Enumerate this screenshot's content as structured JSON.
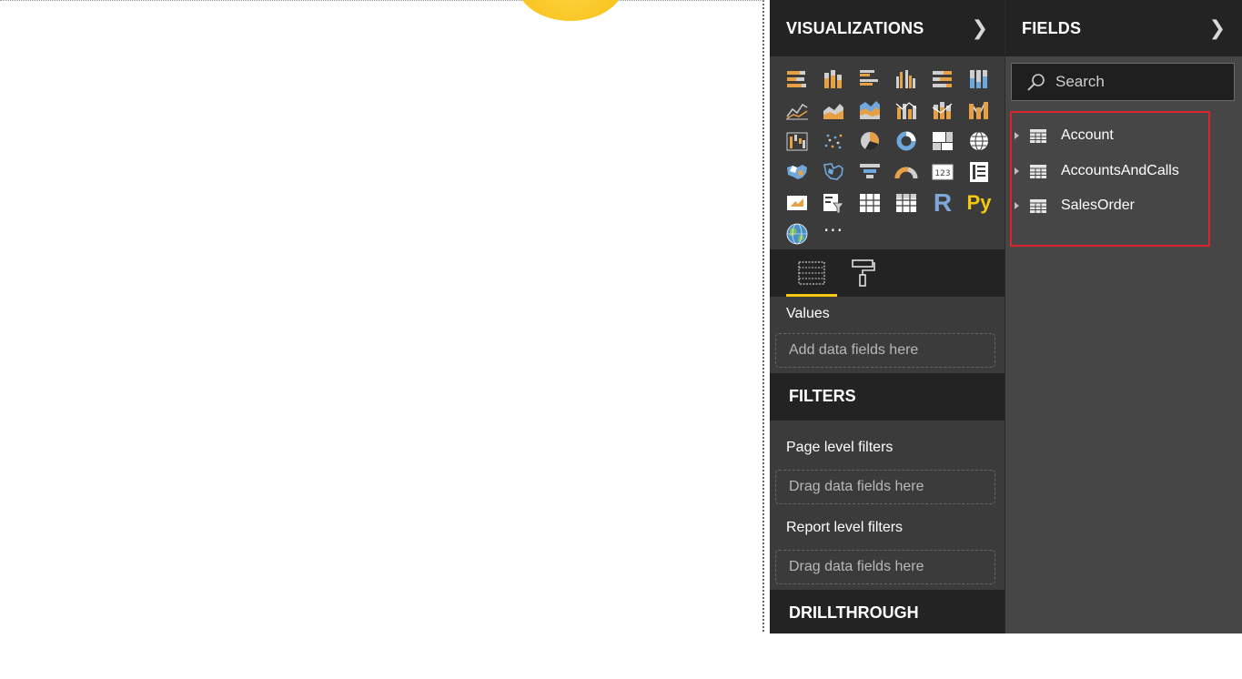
{
  "visualizations": {
    "title": "VISUALIZATIONS",
    "expand_icon": "chevron-right-icon",
    "gallery": [
      "stacked-bar-icon",
      "stacked-column-icon",
      "clustered-bar-icon",
      "clustered-column-icon",
      "100-stacked-bar-icon",
      "100-stacked-column-icon",
      "line-chart-icon",
      "area-chart-icon",
      "stacked-area-icon",
      "line-clustered-column-icon",
      "line-stacked-column-icon",
      "ribbon-chart-icon",
      "waterfall-chart-icon",
      "scatter-chart-icon",
      "pie-chart-icon",
      "donut-chart-icon",
      "treemap-icon",
      "map-icon",
      "filled-map-icon",
      "shape-map-icon",
      "funnel-icon",
      "gauge-icon",
      "card-icon",
      "multi-row-card-icon",
      "kpi-icon",
      "slicer-icon",
      "table-icon",
      "matrix-icon",
      "r-visual-icon",
      "python-visual-icon",
      "arcgis-map-icon",
      "more-visuals-icon"
    ],
    "r_label": "R",
    "py_label": "Py",
    "more_label": "···",
    "tabs": [
      "fields-tab-icon",
      "format-paint-roller-icon"
    ],
    "values_label": "Values",
    "values_placeholder": "Add data fields here"
  },
  "filters": {
    "title": "FILTERS",
    "page_level_label": "Page level filters",
    "page_level_placeholder": "Drag data fields here",
    "report_level_label": "Report level filters",
    "report_level_placeholder": "Drag data fields here"
  },
  "drillthrough": {
    "title": "DRILLTHROUGH"
  },
  "fields": {
    "title": "FIELDS",
    "expand_icon": "chevron-right-icon",
    "search_placeholder": "Search",
    "tables": [
      {
        "name": "Account"
      },
      {
        "name": "AccountsAndCalls"
      },
      {
        "name": "SalesOrder"
      }
    ]
  },
  "colors": {
    "accent_yellow": "#f2c811",
    "highlight_red": "#d9232e",
    "pane_dark": "#232323",
    "pane_mid": "#3b3b3b",
    "fields_bg": "#464646"
  }
}
